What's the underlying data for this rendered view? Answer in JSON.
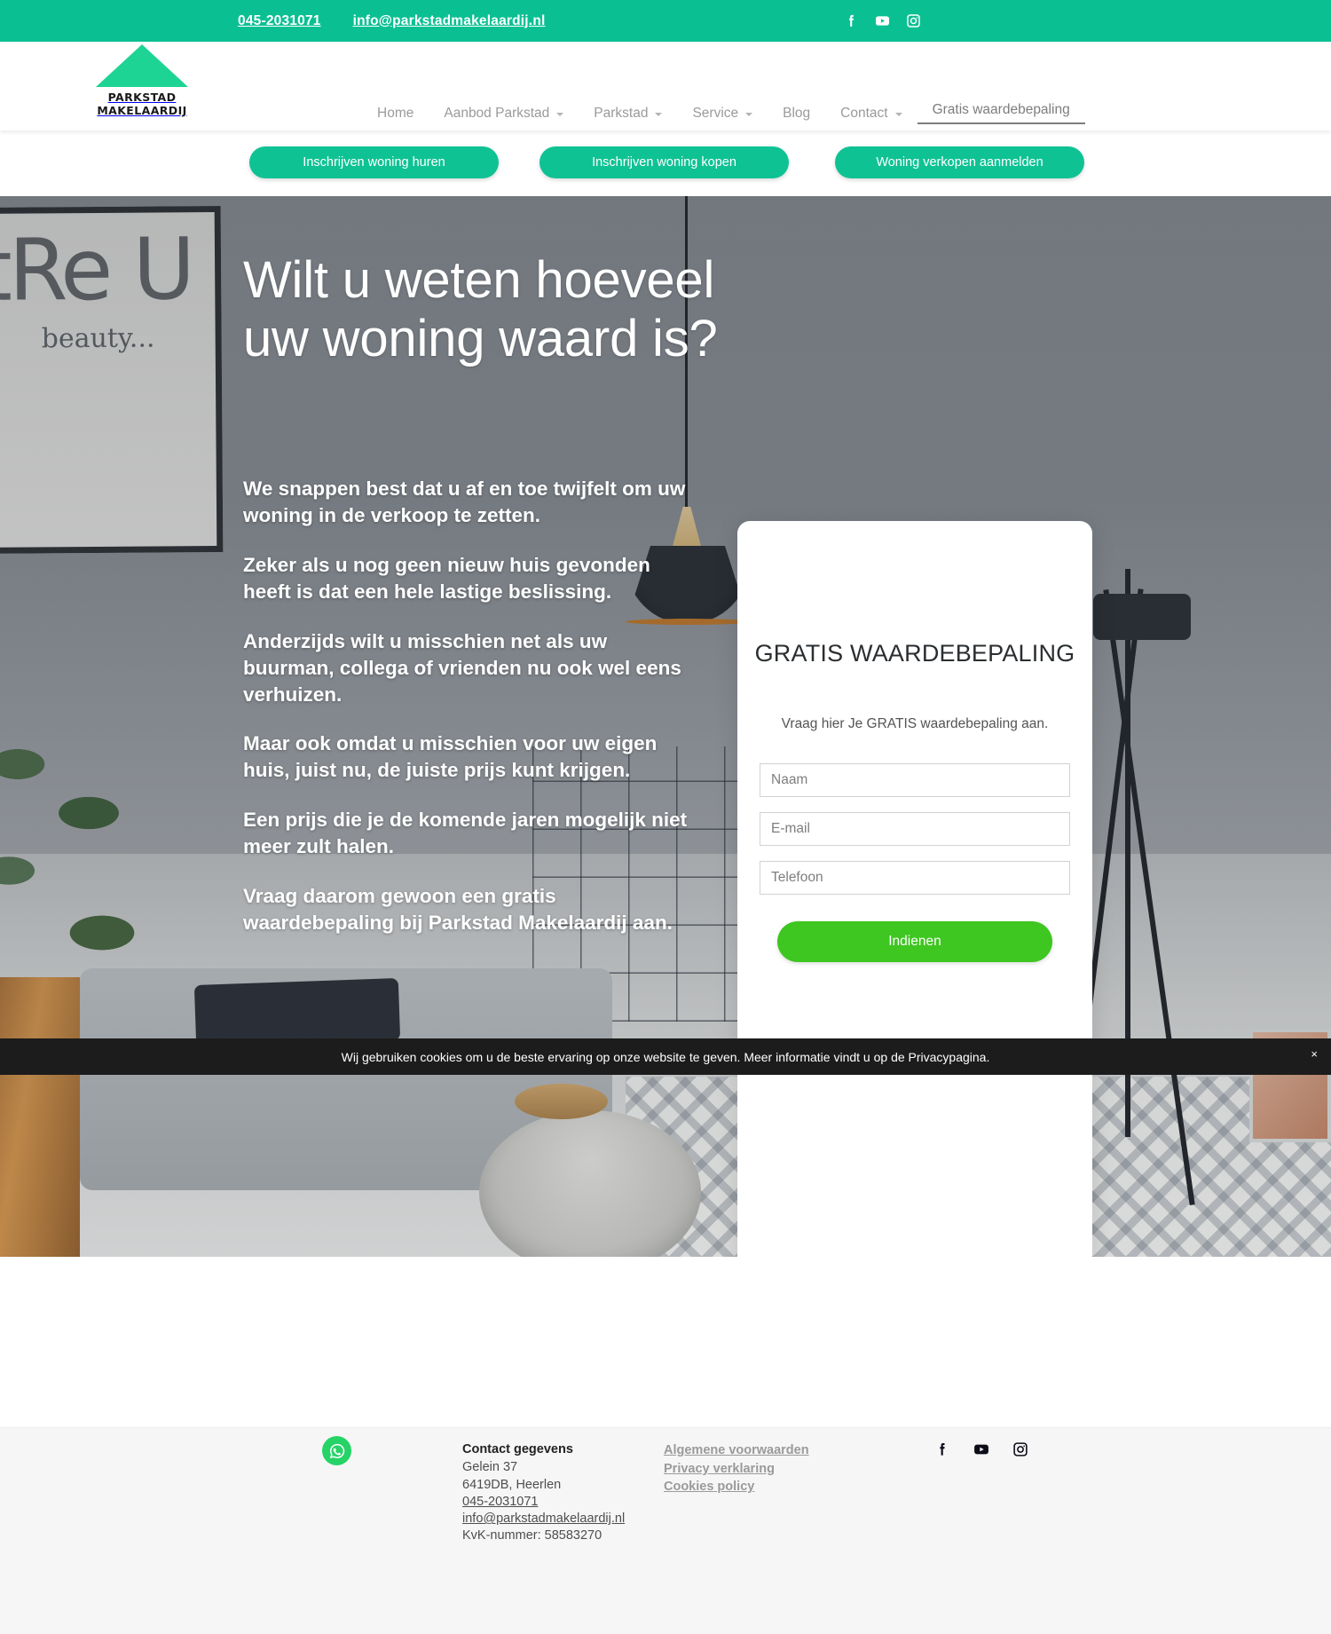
{
  "topbar": {
    "phone": "045-2031071",
    "email": "info@parkstadmakelaardij.nl",
    "social": [
      {
        "name": "facebook-icon"
      },
      {
        "name": "youtube-icon"
      },
      {
        "name": "instagram-icon"
      }
    ]
  },
  "brand": {
    "line1": "PARKSTAD",
    "line2": "MAKELAARDIJ",
    "accent_color": "#0ac093",
    "logo_triangle_color": "#1ed495"
  },
  "nav": {
    "items": [
      {
        "label": "Home",
        "has_dropdown": false,
        "active": false
      },
      {
        "label": "Aanbod Parkstad",
        "has_dropdown": true,
        "active": false
      },
      {
        "label": "Parkstad",
        "has_dropdown": true,
        "active": false
      },
      {
        "label": "Service",
        "has_dropdown": true,
        "active": false
      },
      {
        "label": "Blog",
        "has_dropdown": false,
        "active": false
      },
      {
        "label": "Contact",
        "has_dropdown": true,
        "active": false
      },
      {
        "label": "Gratis waardebepaling",
        "has_dropdown": false,
        "active": true
      }
    ]
  },
  "cta_buttons": [
    {
      "label": "Inschrijven woning huren"
    },
    {
      "label": "Inschrijven woning kopen"
    },
    {
      "label": "Woning verkopen aanmelden"
    }
  ],
  "hero": {
    "title": "Wilt u weten hoeveel uw woning waard is?",
    "paragraphs": [
      "We snappen best dat u af en toe twijfelt om uw woning in de verkoop te zetten.",
      "Zeker als u nog geen nieuw huis gevonden heeft is dat een hele lastige beslissing.",
      "Anderzijds wilt u misschien net als uw buurman, collega of vrienden nu ook wel eens verhuizen.",
      "Maar ook omdat u misschien voor uw eigen huis, juist nu, de juiste prijs kunt krijgen.",
      "Een prijs die je de komende jaren mogelijk niet meer zult halen.",
      "Vraag daarom gewoon een gratis waardebepaling bij Parkstad Makelaardij aan."
    ],
    "art_text": "tRe U",
    "art_sub": "beauty..."
  },
  "form": {
    "title": "GRATIS WAARDEBEPALING",
    "subtitle": "Vraag hier Je GRATIS waardebepaling aan.",
    "fields": [
      {
        "name": "naam",
        "placeholder": "Naam",
        "value": ""
      },
      {
        "name": "email",
        "placeholder": "E-mail",
        "value": ""
      },
      {
        "name": "telefoon",
        "placeholder": "Telefoon",
        "value": ""
      }
    ],
    "submit_label": "Indienen",
    "submit_color": "#3ec621"
  },
  "cookie": {
    "text": "Wij gebruiken cookies om u de beste ervaring op onze website te geven. Meer informatie vindt u op de Privacypagina.",
    "close_label": "×"
  },
  "footer": {
    "whatsapp_icon": "whatsapp-icon",
    "contact": {
      "heading": "Contact gegevens",
      "street": "Gelein 37",
      "city": "6419DB, Heerlen",
      "phone": "045-2031071",
      "email": "info@parkstadmakelaardij.nl",
      "kvk": "KvK-nummer: 58583270"
    },
    "links": [
      {
        "label": "Algemene voorwaarden"
      },
      {
        "label": "Privacy verklaring"
      },
      {
        "label": "Cookies policy"
      }
    ],
    "social": [
      {
        "name": "facebook-icon"
      },
      {
        "name": "youtube-icon"
      },
      {
        "name": "instagram-icon"
      }
    ]
  }
}
